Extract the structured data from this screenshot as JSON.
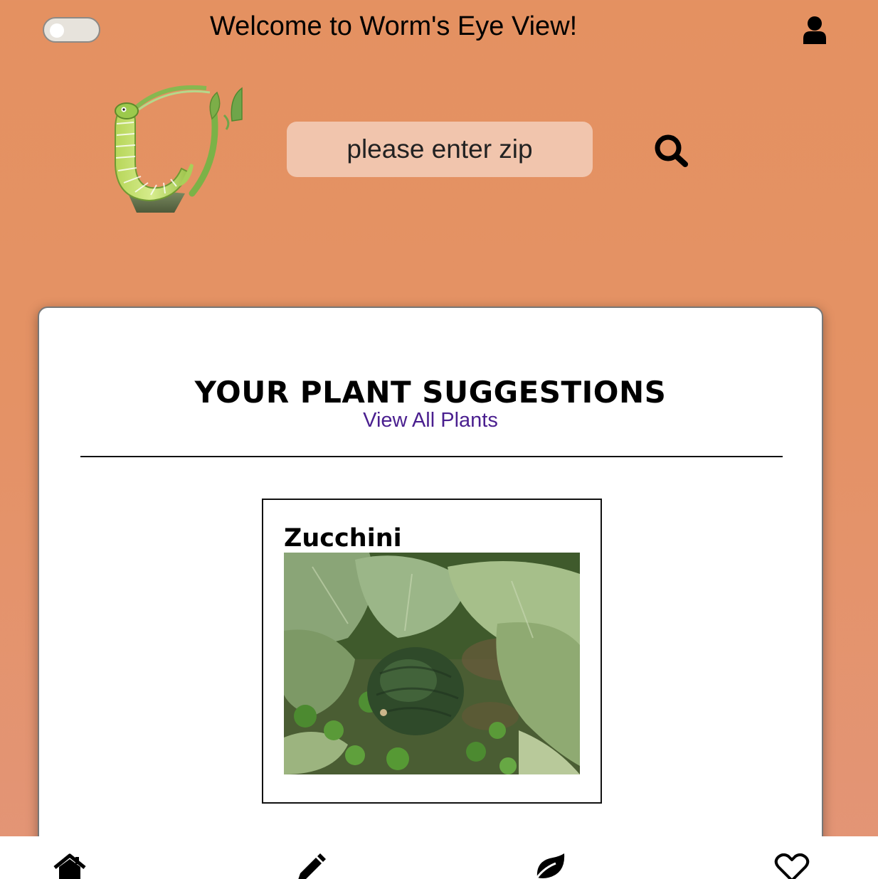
{
  "header": {
    "welcome_text": "Welcome to Worm's Eye View!",
    "theme_toggle_on": false,
    "user_icon": "user-icon"
  },
  "search": {
    "placeholder": "please enter zip",
    "value": "",
    "icon": "search-icon"
  },
  "logo": {
    "icon": "worm-sprout-logo"
  },
  "suggestions": {
    "title": "YOUR PLANT SUGGESTIONS",
    "view_all_link": "View All Plants",
    "plants": [
      {
        "name": "Zucchini"
      }
    ]
  },
  "bottom_nav": {
    "items": [
      {
        "icon": "home-icon"
      },
      {
        "icon": "pencil-icon"
      },
      {
        "icon": "leaf-icon"
      },
      {
        "icon": "heart-icon"
      }
    ]
  },
  "colors": {
    "background": "#e49161",
    "zip_field": "#f1c5ad",
    "link": "#4a1f8f",
    "card": "#ffffff"
  }
}
